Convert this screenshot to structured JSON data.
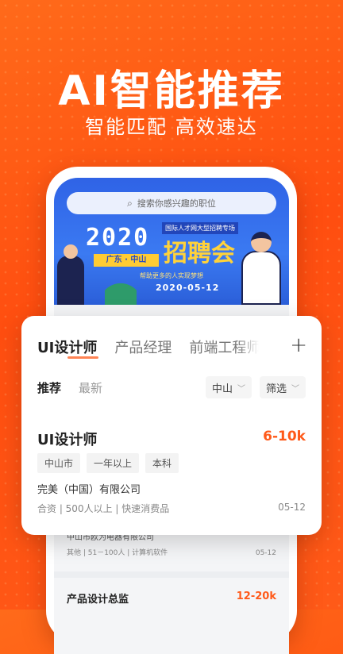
{
  "hero": {
    "headline": "AI智能推荐",
    "subline": "智能匹配 高效速达"
  },
  "app": {
    "search_placeholder": "搜索你感兴趣的职位",
    "banner": {
      "year": "2020",
      "location": "广东 · 中山",
      "note": "国际人才网大型招聘专场",
      "headline": "招聘会",
      "tagline": "帮助更多的人实现梦想",
      "date": "2020-05-12"
    },
    "behind_job": {
      "company": "中山市欧为电器有限公司",
      "meta": "其他 | 51－100人 | 计算机软件",
      "date": "05-12"
    },
    "next_job": {
      "title": "产品设计总监",
      "salary": "12-20k"
    }
  },
  "card": {
    "tabs": [
      {
        "label": "UI设计师"
      },
      {
        "label": "产品经理"
      },
      {
        "label": "前端工程师"
      }
    ],
    "add_label": "+",
    "filters": [
      {
        "label": "推荐"
      },
      {
        "label": "最新"
      }
    ],
    "city_chip": "中山",
    "filter_chip": "筛选",
    "job": {
      "title": "UI设计师",
      "salary": "6-10k",
      "tags": [
        "中山市",
        "一年以上",
        "本科"
      ],
      "company": "完美（中国）有限公司",
      "meta": "合资 | 500人以上 | 快速消费品",
      "date": "05-12"
    }
  },
  "colors": {
    "accent": "#ff5a1a",
    "background": "#ff5214",
    "banner": "#2f63e6"
  }
}
